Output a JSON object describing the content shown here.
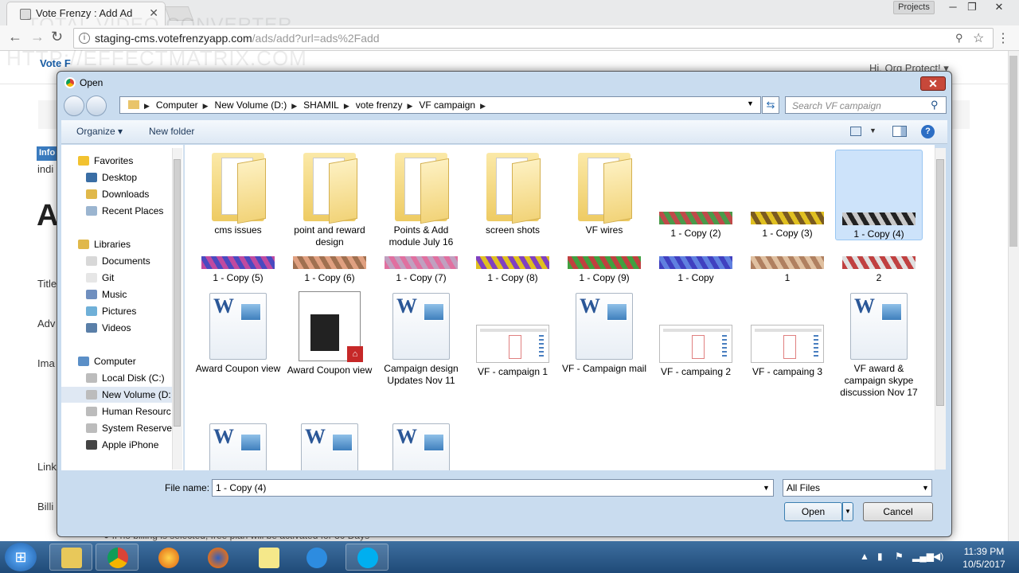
{
  "browser": {
    "tab_title": "Vote Frenzy : Add Ad",
    "profile_label": "Projects",
    "url_host": "staging-cms.votefrenzyapp.com",
    "url_path": "/ads/add?url=ads%2Fadd",
    "watermark_1": "TOTAL VIDEO CONVERTER",
    "watermark_2": "HTTP://EFFECTMATRIX.COM"
  },
  "page": {
    "logo_text": "Vote F",
    "user_text": "Hi, Org Protect! ▾",
    "info_badge": "Info",
    "indi_text": "indi",
    "big_heading": "A",
    "labels": [
      "Title",
      "Adv",
      "Ima",
      "Link",
      "Billi"
    ],
    "bottom_text": "● If no billing is selected, free plan will be activated for 30 Days"
  },
  "dialog": {
    "title": "Open",
    "breadcrumbs": [
      "Computer",
      "New Volume (D:)",
      "SHAMIL",
      "vote frenzy",
      "VF campaign"
    ],
    "search_placeholder": "Search VF campaign",
    "organize_label": "Organize ▾",
    "new_folder_label": "New folder",
    "nav": [
      {
        "label": "Favorites",
        "icon": "star-icon",
        "color": "#f2c230",
        "indent": 0
      },
      {
        "label": "Desktop",
        "icon": "desktop-icon",
        "color": "#3a6ea5",
        "indent": 1
      },
      {
        "label": "Downloads",
        "icon": "downloads-icon",
        "color": "#e0b84a",
        "indent": 1
      },
      {
        "label": "Recent Places",
        "icon": "recent-places-icon",
        "color": "#9bb5d0",
        "indent": 1
      },
      {
        "label": "Libraries",
        "icon": "library-icon",
        "color": "#e0b84a",
        "indent": 0
      },
      {
        "label": "Documents",
        "icon": "documents-icon",
        "color": "#d8d8d8",
        "indent": 1
      },
      {
        "label": "Git",
        "icon": "git-icon",
        "color": "#e6e6e6",
        "indent": 1
      },
      {
        "label": "Music",
        "icon": "music-icon",
        "color": "#6f8fbf",
        "indent": 1
      },
      {
        "label": "Pictures",
        "icon": "pictures-icon",
        "color": "#6fb0d8",
        "indent": 1
      },
      {
        "label": "Videos",
        "icon": "videos-icon",
        "color": "#5a7fa8",
        "indent": 1
      },
      {
        "label": "Computer",
        "icon": "computer-icon",
        "color": "#5b8fc7",
        "indent": 0
      },
      {
        "label": "Local Disk (C:)",
        "icon": "drive-icon",
        "color": "#bcbcbc",
        "indent": 1
      },
      {
        "label": "New Volume (D:",
        "icon": "drive-icon",
        "color": "#bcbcbc",
        "indent": 1,
        "selected": true
      },
      {
        "label": "Human Resourc",
        "icon": "drive-icon",
        "color": "#bcbcbc",
        "indent": 1
      },
      {
        "label": "System Reserve",
        "icon": "drive-icon",
        "color": "#bcbcbc",
        "indent": 1
      },
      {
        "label": "Apple iPhone",
        "icon": "iphone-icon",
        "color": "#444444",
        "indent": 1
      }
    ],
    "files": [
      {
        "label": "cms issues",
        "kind": "folder"
      },
      {
        "label": "point and reward design",
        "kind": "folder"
      },
      {
        "label": "Points & Add module July 16",
        "kind": "folder"
      },
      {
        "label": "screen shots",
        "kind": "folder"
      },
      {
        "label": "VF wires",
        "kind": "folder"
      },
      {
        "label": "1 - Copy (2)",
        "kind": "strip",
        "colors": [
          "#4a9a4a",
          "#c04a4a"
        ]
      },
      {
        "label": "1 - Copy (3)",
        "kind": "strip",
        "colors": [
          "#e0c020",
          "#7a5a20"
        ]
      },
      {
        "label": "1 - Copy (4)",
        "kind": "strip",
        "colors": [
          "#222222",
          "#c8c8c8"
        ],
        "selected": true
      },
      {
        "label": "1 - Copy (5)",
        "kind": "strip",
        "colors": [
          "#c04aa0",
          "#4a4ac0"
        ]
      },
      {
        "label": "1 - Copy (6)",
        "kind": "strip",
        "colors": [
          "#a07050",
          "#e0a080"
        ]
      },
      {
        "label": "1 - Copy (7)",
        "kind": "strip",
        "colors": [
          "#e070a0",
          "#c0a0c0"
        ]
      },
      {
        "label": "1 - Copy (8)",
        "kind": "strip",
        "colors": [
          "#e0c020",
          "#8040c0"
        ]
      },
      {
        "label": "1 - Copy (9)",
        "kind": "strip",
        "colors": [
          "#40a040",
          "#c04040"
        ]
      },
      {
        "label": "1 - Copy",
        "kind": "strip",
        "colors": [
          "#4040c0",
          "#6080e0"
        ]
      },
      {
        "label": "1",
        "kind": "strip",
        "colors": [
          "#b08060",
          "#e0c0a0"
        ]
      },
      {
        "label": "2",
        "kind": "strip",
        "colors": [
          "#c04040",
          "#e0e0e0"
        ]
      },
      {
        "label": "Award Coupon view",
        "kind": "word"
      },
      {
        "label": "Award Coupon view",
        "kind": "pdf"
      },
      {
        "label": "Campaign design Updates Nov 11",
        "kind": "word"
      },
      {
        "label": "VF - campaign 1",
        "kind": "shot"
      },
      {
        "label": "VF - Campaign mail",
        "kind": "word"
      },
      {
        "label": "VF - campaing 2",
        "kind": "shot"
      },
      {
        "label": "VF - campaing 3",
        "kind": "shot"
      },
      {
        "label": "VF award & campaign skype discussion Nov 17",
        "kind": "word"
      },
      {
        "label": "",
        "kind": "word"
      },
      {
        "label": "",
        "kind": "word"
      },
      {
        "label": "",
        "kind": "word"
      }
    ],
    "file_name_label": "File name:",
    "file_name_value": "1 - Copy (4)",
    "filter_value": "All Files",
    "open_label": "Open",
    "cancel_label": "Cancel"
  },
  "taskbar": {
    "time": "11:39 PM",
    "date": "10/5/2017"
  }
}
